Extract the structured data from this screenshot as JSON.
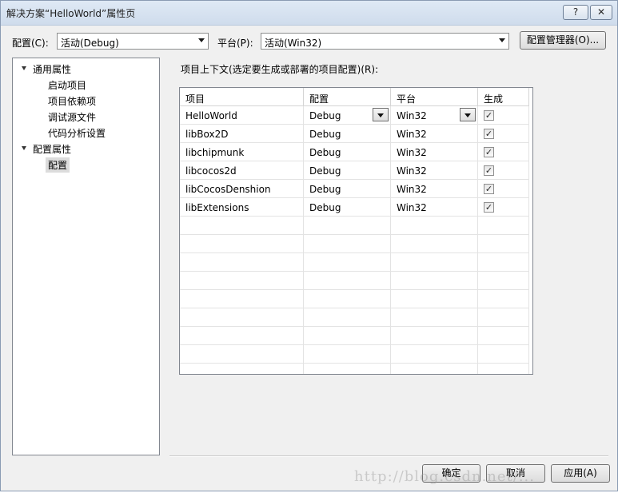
{
  "window": {
    "title": "解决方案“HelloWorld”属性页"
  },
  "titlebar": {
    "help_label": "?",
    "close_label": "✕"
  },
  "config": {
    "label": "配置(C):",
    "value": "活动(Debug)",
    "platform_label": "平台(P):",
    "platform_value": "活动(Win32)",
    "manager_button": "配置管理器(O)..."
  },
  "tree": {
    "common": "通用属性",
    "common_items": [
      "启动项目",
      "项目依赖项",
      "调试源文件",
      "代码分析设置"
    ],
    "config": "配置属性",
    "config_items": [
      "配置"
    ]
  },
  "context_label": "项目上下文(选定要生成或部署的项目配置)(R):",
  "grid": {
    "headers": [
      "项目",
      "配置",
      "平台",
      "生成"
    ],
    "rows": [
      {
        "project": "HelloWorld",
        "config": "Debug",
        "platform": "Win32",
        "build": true
      },
      {
        "project": "libBox2D",
        "config": "Debug",
        "platform": "Win32",
        "build": true
      },
      {
        "project": "libchipmunk",
        "config": "Debug",
        "platform": "Win32",
        "build": true
      },
      {
        "project": "libcocos2d",
        "config": "Debug",
        "platform": "Win32",
        "build": true
      },
      {
        "project": "libCocosDenshion",
        "config": "Debug",
        "platform": "Win32",
        "build": true
      },
      {
        "project": "libExtensions",
        "config": "Debug",
        "platform": "Win32",
        "build": true
      }
    ],
    "check_glyph": "✓"
  },
  "buttons": {
    "ok": "确定",
    "cancel": "取消",
    "apply": "应用(A)"
  },
  "watermark": "http://blog.csdn.net/..."
}
